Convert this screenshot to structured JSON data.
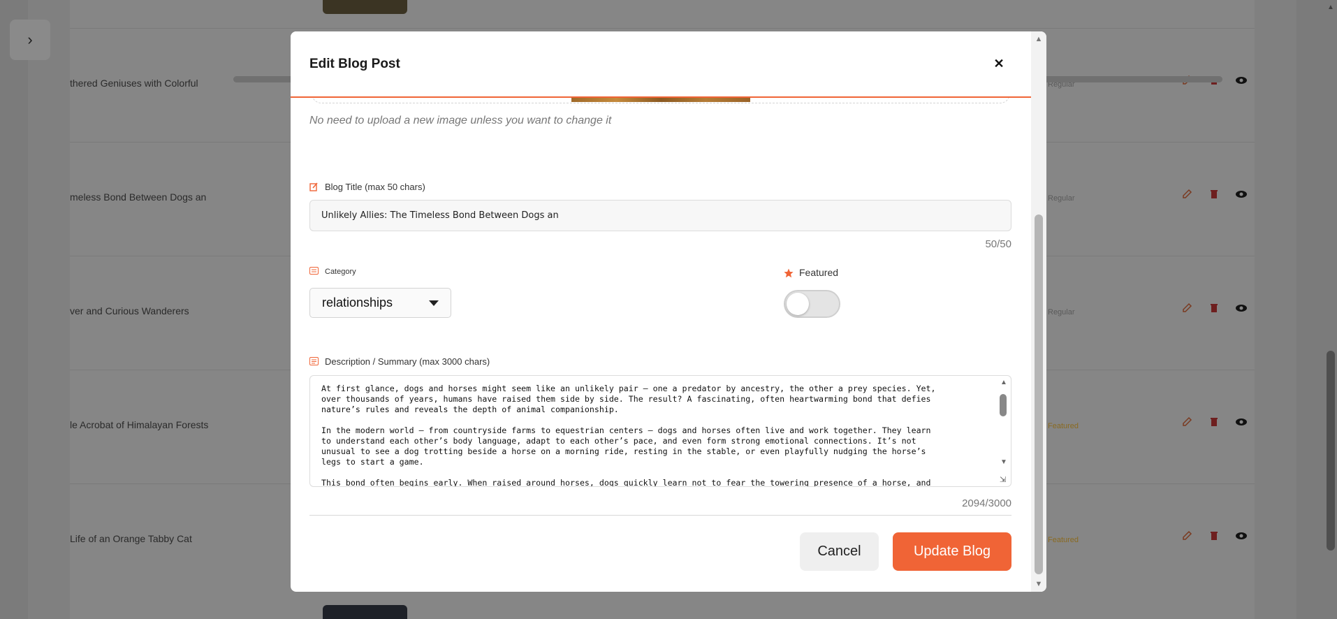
{
  "background": {
    "rows": [
      {
        "title": "thered Geniuses with Colorful",
        "badge": "Regular",
        "featured": false
      },
      {
        "title": "meless Bond Between Dogs an",
        "badge": "Regular",
        "featured": false
      },
      {
        "title": "ver and Curious Wanderers",
        "badge": "Regular",
        "featured": false
      },
      {
        "title": "le Acrobat of Himalayan Forests",
        "badge": "Featured",
        "featured": true
      },
      {
        "title": "Life of an Orange Tabby Cat",
        "badge": "Featured",
        "featured": true
      }
    ],
    "sidebar_toggle_icon": "chevron-right-icon"
  },
  "modal": {
    "title": "Edit Blog Post",
    "close_icon": "close-icon",
    "image_hint": "No need to upload a new image unless you want to change it",
    "blog_title": {
      "label": "Blog Title (max 50 chars)",
      "value": "Unlikely Allies: The Timeless Bond Between Dogs an",
      "count": "50/50"
    },
    "category": {
      "label": "Category",
      "selected": "relationships"
    },
    "featured": {
      "label": "Featured",
      "enabled": false
    },
    "description": {
      "label": "Description / Summary (max 3000 chars)",
      "value": "At first glance, dogs and horses might seem like an unlikely pair — one a predator by ancestry, the other a prey species. Yet,\nover thousands of years, humans have raised them side by side. The result? A fascinating, often heartwarming bond that defies\nnature’s rules and reveals the depth of animal companionship.\n\nIn the modern world — from countryside farms to equestrian centers — dogs and horses often live and work together. They learn\nto understand each other’s body language, adapt to each other’s pace, and even form strong emotional connections. It’s not\nunusual to see a dog trotting beside a horse on a morning ride, resting in the stable, or even playfully nudging the horse’s\nlegs to start a game.\n\nThis bond often begins early. When raised around horses, dogs quickly learn not to fear the towering presence of a horse, and",
      "count": "2094/3000"
    },
    "buttons": {
      "cancel": "Cancel",
      "update": "Update Blog"
    }
  },
  "colors": {
    "accent": "#f06436",
    "overlay": "#7b7b7b"
  }
}
